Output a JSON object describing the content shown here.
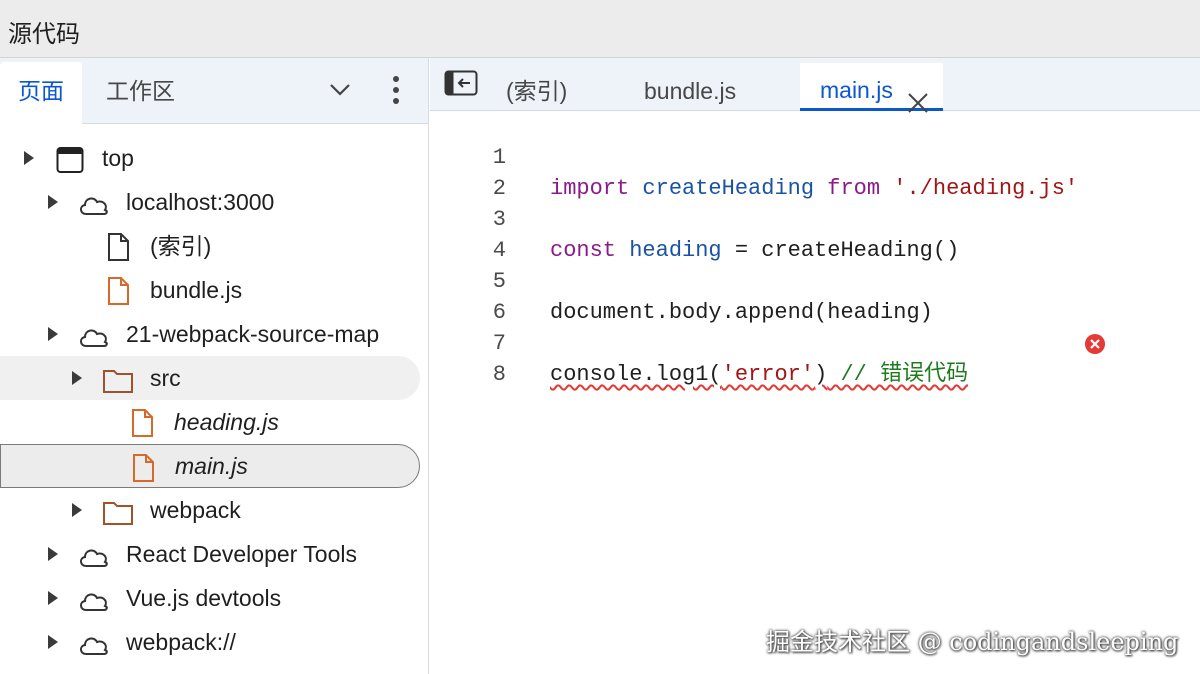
{
  "window": {
    "title": "源代码"
  },
  "navigator": {
    "tabs": [
      {
        "label": "页面",
        "active": true
      },
      {
        "label": "工作区",
        "active": false
      }
    ],
    "tree": [
      {
        "label": "top",
        "icon": "frame-icon"
      },
      {
        "label": "localhost:3000",
        "icon": "cloud-icon"
      },
      {
        "label": "(索引)",
        "icon": "file-icon"
      },
      {
        "label": "bundle.js",
        "icon": "js-file-icon"
      },
      {
        "label": "21-webpack-source-map",
        "icon": "cloud-icon"
      },
      {
        "label": "src",
        "icon": "folder-icon"
      },
      {
        "label": "heading.js",
        "icon": "js-file-icon"
      },
      {
        "label": "main.js",
        "icon": "js-file-icon"
      },
      {
        "label": "webpack",
        "icon": "folder-icon"
      },
      {
        "label": "React Developer Tools",
        "icon": "cloud-icon"
      },
      {
        "label": "Vue.js devtools",
        "icon": "cloud-icon"
      },
      {
        "label": "webpack://",
        "icon": "cloud-icon"
      }
    ]
  },
  "editor": {
    "tabs": [
      {
        "label": "(索引)"
      },
      {
        "label": "bundle.js"
      },
      {
        "label": "main.js",
        "active": true
      }
    ],
    "lines": [
      {
        "n": "1",
        "t1": "import",
        "t2": " createHeading ",
        "t3": "from",
        "t4": " './heading.js'"
      },
      {
        "n": "2"
      },
      {
        "n": "3",
        "t1": "const",
        "t2": " heading",
        "t3": " = createHeading()"
      },
      {
        "n": "4"
      },
      {
        "n": "5",
        "t1": "document.body.append(heading)"
      },
      {
        "n": "6"
      },
      {
        "n": "7",
        "t1": "console.log1(",
        "t2": "'error'",
        "t3": ")",
        "t4": " // 错误代码"
      },
      {
        "n": "8"
      }
    ]
  },
  "watermark": "掘金技术社区 @ codingandsleeping",
  "colors": {
    "accent": "#0b57d0",
    "keyword": "#8b1a8b",
    "variable": "#1a53a6",
    "string": "#a31515",
    "comment": "#1e7b1e",
    "error": "#e53935",
    "js_file": "#d9692b",
    "folder": "#a0522d"
  }
}
